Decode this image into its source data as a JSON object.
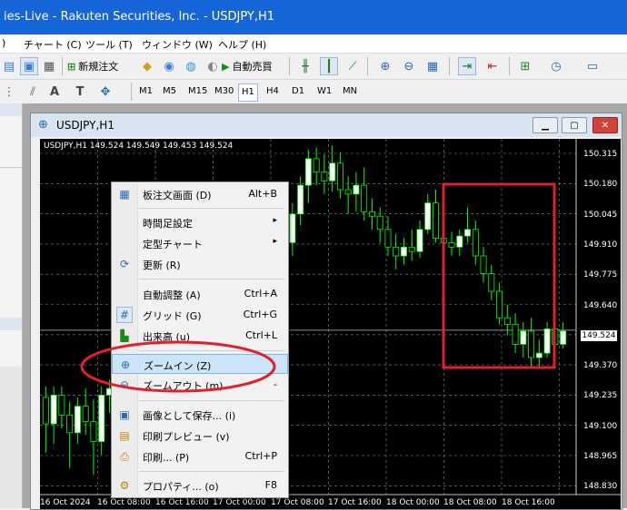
{
  "window": {
    "title": "ies-Live - Rakuten Securities, Inc. - USDJPY,H1"
  },
  "menu": [
    {
      "label": ")"
    },
    {
      "label": "チャート (C)"
    },
    {
      "label": "ツール (T)"
    },
    {
      "label": "ウィンドウ (W)"
    },
    {
      "label": "ヘルプ (H)"
    }
  ],
  "toolbar": {
    "new_order": "新規注文",
    "auto_trading": "自動売買",
    "timeframes": [
      "M1",
      "M5",
      "M15",
      "M30",
      "H1",
      "H4",
      "D1",
      "W1",
      "MN"
    ],
    "active_timeframe": "H1"
  },
  "chart": {
    "title": "USDJPY,H1",
    "ohlc": "USDJPY,H1  149.524 149.549 149.453 149.524",
    "current_price": "149.524",
    "price_labels": [
      "150.315",
      "150.180",
      "150.045",
      "149.910",
      "149.775",
      "149.640",
      "149.505",
      "149.370",
      "149.235",
      "149.100",
      "148.965",
      "148.830"
    ],
    "time_labels": [
      "16 Oct 2024",
      "16 Oct 08:00",
      "16 Oct 16:00",
      "17 Oct 00:00",
      "17 Oct 08:00",
      "17 Oct 16:00",
      "18 Oct 00:00",
      "18 Oct 08:00",
      "18 Oct 16:00"
    ],
    "colors": {
      "background": "#000000",
      "bull": "#ffffff",
      "bear": "#00ff00",
      "grid": "#8a8a8a",
      "highlight_box": "#e0202a"
    }
  },
  "chart_data": {
    "type": "candlestick",
    "symbol": "USDJPY",
    "timeframe": "H1",
    "ylim": [
      148.78,
      150.39
    ],
    "candles": [
      {
        "o": 149.22,
        "h": 149.27,
        "l": 148.97,
        "c": 149.1
      },
      {
        "o": 149.1,
        "h": 149.27,
        "l": 149.01,
        "c": 149.23
      },
      {
        "o": 149.23,
        "h": 149.27,
        "l": 149.08,
        "c": 149.14
      },
      {
        "o": 149.14,
        "h": 149.2,
        "l": 148.9,
        "c": 149.06
      },
      {
        "o": 149.06,
        "h": 149.22,
        "l": 149.01,
        "c": 149.18
      },
      {
        "o": 149.18,
        "h": 149.26,
        "l": 149.05,
        "c": 149.11
      },
      {
        "o": 149.11,
        "h": 149.21,
        "l": 148.87,
        "c": 149.02
      },
      {
        "o": 149.02,
        "h": 149.27,
        "l": 148.96,
        "c": 149.23
      },
      {
        "o": 149.23,
        "h": 149.3,
        "l": 149.15,
        "c": 149.26
      },
      {
        "o": 149.26,
        "h": 149.32,
        "l": 149.21,
        "c": 149.28
      },
      {
        "o": 149.28,
        "h": 149.35,
        "l": 149.22,
        "c": 149.32
      },
      {
        "o": 149.32,
        "h": 149.4,
        "l": 149.25,
        "c": 149.36
      },
      {
        "o": 149.36,
        "h": 149.42,
        "l": 149.28,
        "c": 149.33
      },
      {
        "o": 149.33,
        "h": 149.45,
        "l": 149.3,
        "c": 149.4
      },
      {
        "o": 149.4,
        "h": 149.48,
        "l": 149.32,
        "c": 149.44
      },
      {
        "o": 149.44,
        "h": 149.52,
        "l": 149.38,
        "c": 149.47
      },
      {
        "o": 149.47,
        "h": 149.55,
        "l": 149.4,
        "c": 149.5
      },
      {
        "o": 149.5,
        "h": 149.58,
        "l": 149.44,
        "c": 149.53
      },
      {
        "o": 149.53,
        "h": 149.6,
        "l": 149.48,
        "c": 149.56
      },
      {
        "o": 149.56,
        "h": 149.62,
        "l": 149.5,
        "c": 149.58
      },
      {
        "o": 149.58,
        "h": 149.7,
        "l": 149.55,
        "c": 149.66
      },
      {
        "o": 149.66,
        "h": 149.82,
        "l": 149.6,
        "c": 149.78
      },
      {
        "o": 149.78,
        "h": 149.84,
        "l": 149.64,
        "c": 149.7
      },
      {
        "o": 149.7,
        "h": 149.8,
        "l": 149.5,
        "c": 149.55
      },
      {
        "o": 149.55,
        "h": 149.72,
        "l": 149.5,
        "c": 149.66
      },
      {
        "o": 149.66,
        "h": 149.76,
        "l": 149.58,
        "c": 149.62
      },
      {
        "o": 149.62,
        "h": 149.72,
        "l": 149.47,
        "c": 149.52
      },
      {
        "o": 149.52,
        "h": 149.62,
        "l": 149.45,
        "c": 149.58
      },
      {
        "o": 149.58,
        "h": 149.88,
        "l": 149.55,
        "c": 149.84
      },
      {
        "o": 149.84,
        "h": 150.06,
        "l": 149.8,
        "c": 150.02
      },
      {
        "o": 150.02,
        "h": 150.12,
        "l": 149.86,
        "c": 149.92
      },
      {
        "o": 149.92,
        "h": 150.1,
        "l": 149.86,
        "c": 150.05
      },
      {
        "o": 150.05,
        "h": 150.22,
        "l": 150.0,
        "c": 150.18
      },
      {
        "o": 150.18,
        "h": 150.34,
        "l": 150.1,
        "c": 150.3
      },
      {
        "o": 150.3,
        "h": 150.35,
        "l": 150.18,
        "c": 150.24
      },
      {
        "o": 150.24,
        "h": 150.32,
        "l": 150.14,
        "c": 150.2
      },
      {
        "o": 150.2,
        "h": 150.36,
        "l": 150.15,
        "c": 150.28
      },
      {
        "o": 150.28,
        "h": 150.33,
        "l": 150.12,
        "c": 150.16
      },
      {
        "o": 150.16,
        "h": 150.22,
        "l": 150.05,
        "c": 150.14
      },
      {
        "o": 150.14,
        "h": 150.24,
        "l": 150.06,
        "c": 150.18
      },
      {
        "o": 150.18,
        "h": 150.26,
        "l": 150.02,
        "c": 150.06
      },
      {
        "o": 150.06,
        "h": 150.12,
        "l": 149.98,
        "c": 150.04
      },
      {
        "o": 150.04,
        "h": 150.08,
        "l": 149.92,
        "c": 149.98
      },
      {
        "o": 149.98,
        "h": 150.04,
        "l": 149.86,
        "c": 149.9
      },
      {
        "o": 149.9,
        "h": 149.96,
        "l": 149.8,
        "c": 149.86
      },
      {
        "o": 149.86,
        "h": 149.94,
        "l": 149.82,
        "c": 149.9
      },
      {
        "o": 149.9,
        "h": 149.98,
        "l": 149.84,
        "c": 149.88
      },
      {
        "o": 149.88,
        "h": 150.02,
        "l": 149.85,
        "c": 149.98
      },
      {
        "o": 149.98,
        "h": 150.14,
        "l": 149.96,
        "c": 150.1
      },
      {
        "o": 150.1,
        "h": 150.16,
        "l": 149.92,
        "c": 149.94
      },
      {
        "o": 149.94,
        "h": 149.98,
        "l": 149.88,
        "c": 149.92
      },
      {
        "o": 149.92,
        "h": 149.97,
        "l": 149.86,
        "c": 149.9
      },
      {
        "o": 149.9,
        "h": 149.98,
        "l": 149.86,
        "c": 149.95
      },
      {
        "o": 149.95,
        "h": 150.08,
        "l": 149.92,
        "c": 149.98
      },
      {
        "o": 149.98,
        "h": 150.02,
        "l": 149.82,
        "c": 149.86
      },
      {
        "o": 149.86,
        "h": 149.9,
        "l": 149.74,
        "c": 149.78
      },
      {
        "o": 149.78,
        "h": 149.82,
        "l": 149.66,
        "c": 149.7
      },
      {
        "o": 149.7,
        "h": 149.74,
        "l": 149.55,
        "c": 149.58
      },
      {
        "o": 149.58,
        "h": 149.64,
        "l": 149.5,
        "c": 149.55
      },
      {
        "o": 149.55,
        "h": 149.6,
        "l": 149.42,
        "c": 149.46
      },
      {
        "o": 149.46,
        "h": 149.56,
        "l": 149.4,
        "c": 149.52
      },
      {
        "o": 149.52,
        "h": 149.58,
        "l": 149.36,
        "c": 149.4
      },
      {
        "o": 149.4,
        "h": 149.48,
        "l": 149.36,
        "c": 149.42
      },
      {
        "o": 149.42,
        "h": 149.56,
        "l": 149.4,
        "c": 149.53
      },
      {
        "o": 149.53,
        "h": 149.6,
        "l": 149.42,
        "c": 149.46
      },
      {
        "o": 149.46,
        "h": 149.56,
        "l": 149.44,
        "c": 149.52
      }
    ]
  },
  "context_menu": {
    "items": [
      {
        "icon": "order-book-icon",
        "label": "板注文画面 (D)",
        "shortcut": "Alt+B",
        "arrow": ""
      },
      {
        "icon": "",
        "label": "時間足設定",
        "shortcut": "",
        "arrow": "▸"
      },
      {
        "icon": "",
        "label": "定型チャート",
        "shortcut": "",
        "arrow": "▸"
      },
      {
        "icon": "refresh-icon",
        "label": "更新 (R)",
        "shortcut": "",
        "arrow": ""
      },
      {
        "icon": "",
        "label": "自動調整 (A)",
        "shortcut": "Ctrl+A",
        "arrow": ""
      },
      {
        "icon": "grid-icon",
        "label": "グリッド (G)",
        "shortcut": "Ctrl+G",
        "arrow": ""
      },
      {
        "icon": "volume-icon",
        "label": "出来高 (u)",
        "shortcut": "Ctrl+L",
        "arrow": ""
      },
      {
        "icon": "zoom-in-icon",
        "label": "ズームイン (Z)",
        "shortcut": "",
        "arrow": ""
      },
      {
        "icon": "zoom-out-icon",
        "label": "ズームアウト (m)",
        "shortcut": "-",
        "arrow": ""
      },
      {
        "icon": "save-image-icon",
        "label": "画像として保存... (i)",
        "shortcut": "",
        "arrow": ""
      },
      {
        "icon": "print-preview-icon",
        "label": "印刷プレビュー (v)",
        "shortcut": "",
        "arrow": ""
      },
      {
        "icon": "print-icon",
        "label": "印刷... (P)",
        "shortcut": "Ctrl+P",
        "arrow": ""
      },
      {
        "icon": "properties-icon",
        "label": "プロパティ... (o)",
        "shortcut": "F8",
        "arrow": ""
      }
    ]
  }
}
